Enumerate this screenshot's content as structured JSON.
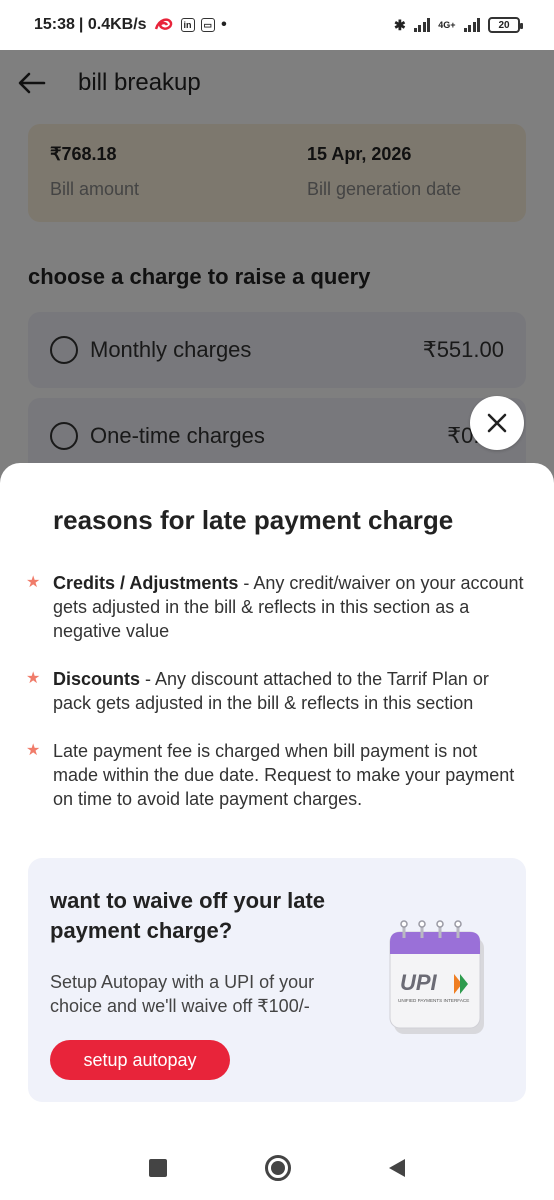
{
  "status_bar": {
    "time": "15:38",
    "speed": "| 0.4KB/s",
    "battery": "20",
    "network_label": "4G+"
  },
  "header": {
    "title": "bill breakup"
  },
  "summary": {
    "bill_amount_value": "₹768.18",
    "bill_amount_label": "Bill amount",
    "generation_date_value": "15 Apr, 2026",
    "generation_date_label": "Bill generation date"
  },
  "charges_section": {
    "title": "choose a charge to raise a query",
    "items": [
      {
        "label": "Monthly charges",
        "amount": "₹551.00"
      },
      {
        "label": "One-time charges",
        "amount": "₹0.00"
      }
    ]
  },
  "sheet": {
    "title": "reasons for late payment charge",
    "reasons": [
      {
        "bold": "Credits / Adjustments",
        "text": " - Any credit/waiver on your account gets adjusted in the bill & reflects in this section as a negative value"
      },
      {
        "bold": "Discounts",
        "text": " - Any discount attached to the Tarrif Plan or pack gets adjusted in the bill & reflects in this section"
      },
      {
        "bold": "",
        "text": "Late payment fee is charged when bill payment is not made within the due date. Request to make your payment on time to avoid late payment charges."
      }
    ],
    "promo": {
      "title": "want to waive off your late payment charge?",
      "description": "Setup Autopay with a UPI of your choice and we'll waive off ₹100/-",
      "button_label": "setup autopay",
      "logo_text": "UPI",
      "logo_subtext": "UNIFIED PAYMENTS INTERFACE"
    }
  },
  "colors": {
    "accent": "#e8243a",
    "summary_card_bg": "#fbf1dc",
    "promo_bg": "#f0f2fa",
    "star": "#f07c6a"
  },
  "icons": [
    "back-arrow-icon",
    "close-icon",
    "star-icon",
    "upi-calendar-icon",
    "nav-recents-icon",
    "nav-home-icon",
    "nav-back-icon"
  ]
}
